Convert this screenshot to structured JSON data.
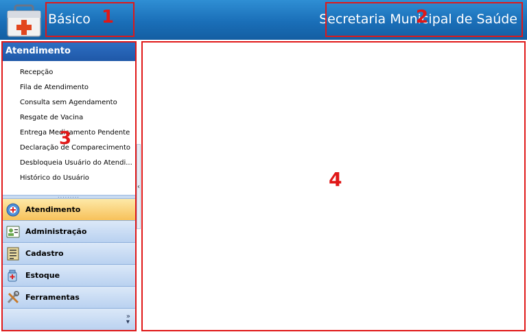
{
  "header": {
    "title": "Básico",
    "organization": "Secretaria Municipal de Saúde"
  },
  "sidebar": {
    "section_title": "Atendimento",
    "menu_items": [
      {
        "label": "Recepção"
      },
      {
        "label": "Fila de Atendimento"
      },
      {
        "label": "Consulta sem Agendamento"
      },
      {
        "label": "Resgate de Vacina"
      },
      {
        "label": "Entrega Medicamento Pendente"
      },
      {
        "label": "Declaração de Comparecimento"
      },
      {
        "label": "Desbloqueia Usuário do Atendi..."
      },
      {
        "label": "Histórico do Usuário"
      }
    ],
    "nav_buttons": [
      {
        "label": "Atendimento",
        "icon": "atendimento-icon",
        "active": true
      },
      {
        "label": "Administração",
        "icon": "administracao-icon",
        "active": false
      },
      {
        "label": "Cadastro",
        "icon": "cadastro-icon",
        "active": false
      },
      {
        "label": "Estoque",
        "icon": "estoque-icon",
        "active": false
      },
      {
        "label": "Ferramentas",
        "icon": "ferramentas-icon",
        "active": false
      }
    ],
    "overflow_glyph": "»"
  },
  "annotations": {
    "header_title": "1",
    "header_org": "2",
    "sidebar": "3",
    "content": "4"
  },
  "colors": {
    "header_blue": "#1a6fb8",
    "section_blue": "#2d6fc4",
    "active_orange": "#f7c15a",
    "annotation_red": "#e01818"
  }
}
